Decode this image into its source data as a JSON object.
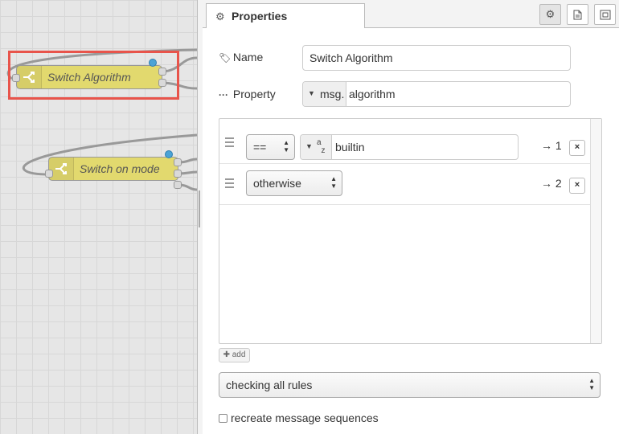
{
  "workspace": {
    "nodes": [
      {
        "label": "Switch Algorithm",
        "selected": true
      },
      {
        "label": "Switch on mode",
        "selected": false
      }
    ]
  },
  "sidebar": {
    "tab_title": "Properties",
    "tab_buttons": [
      {
        "icon": "gear-icon",
        "active": true
      },
      {
        "icon": "document-icon",
        "active": false
      },
      {
        "icon": "frame-icon",
        "active": false
      }
    ]
  },
  "form": {
    "name_label": "Name",
    "name_value": "Switch Algorithm",
    "property_label": "Property",
    "property_prefix": "msg.",
    "property_value": "algorithm",
    "rules": [
      {
        "operator": "==",
        "value_type": "a z",
        "value": "builtin",
        "output": "→ 1",
        "delete": "×"
      },
      {
        "operator": "otherwise",
        "output": "→ 2",
        "delete": "×"
      }
    ],
    "add_label": "add",
    "check_mode": "checking all rules",
    "recreate_label": "recreate message sequences"
  },
  "colors": {
    "node_fill": "#e2d96e",
    "selection": "#e8544b",
    "port_dot": "#4ba3d6"
  }
}
